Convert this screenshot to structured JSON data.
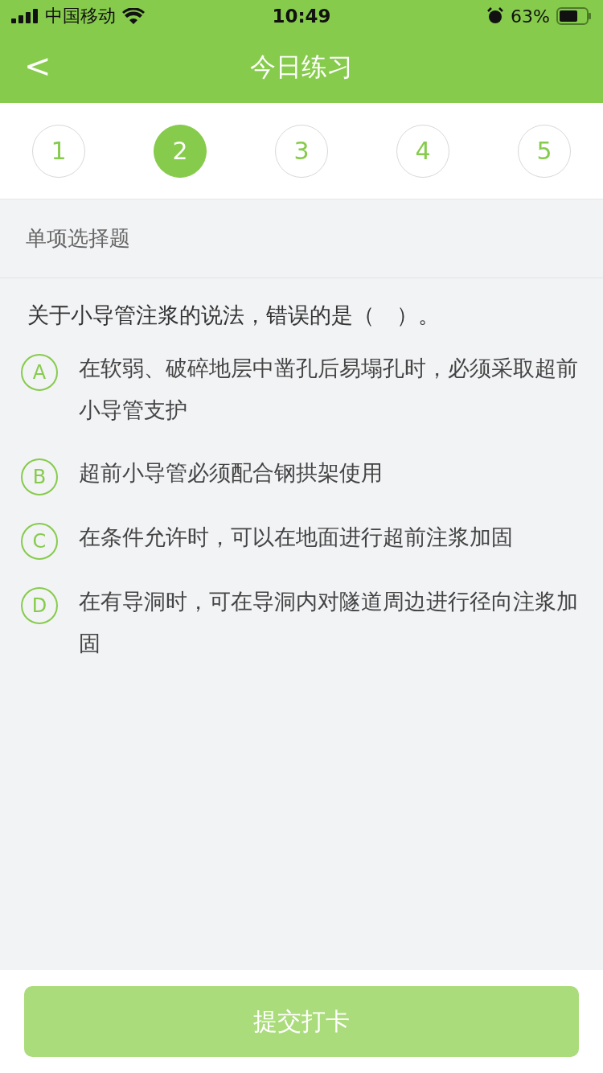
{
  "status_bar": {
    "carrier": "中国移动",
    "time": "10:49",
    "battery": "63%"
  },
  "nav": {
    "back": "<",
    "title": "今日练习"
  },
  "steps": [
    {
      "label": "1",
      "selected": false
    },
    {
      "label": "2",
      "selected": true
    },
    {
      "label": "3",
      "selected": false
    },
    {
      "label": "4",
      "selected": false
    },
    {
      "label": "5",
      "selected": false
    }
  ],
  "section": "单项选择题",
  "question": "关于小导管注浆的说法，错误的是（　）。",
  "options": [
    {
      "letter": "A",
      "text": "在软弱、破碎地层中凿孔后易塌孔时，必须采取超前小导管支护",
      "selected": false
    },
    {
      "letter": "B",
      "text": "超前小导管必须配合钢拱架使用",
      "selected": false
    },
    {
      "letter": "C",
      "text": "在条件允许时，可以在地面进行超前注浆加固",
      "selected": false
    },
    {
      "letter": "D",
      "text": "在有导洞时，可在导洞内对隧道周边进行径向注浆加固",
      "selected": false
    }
  ],
  "submit": {
    "label": "提交打卡",
    "disabled": true
  }
}
